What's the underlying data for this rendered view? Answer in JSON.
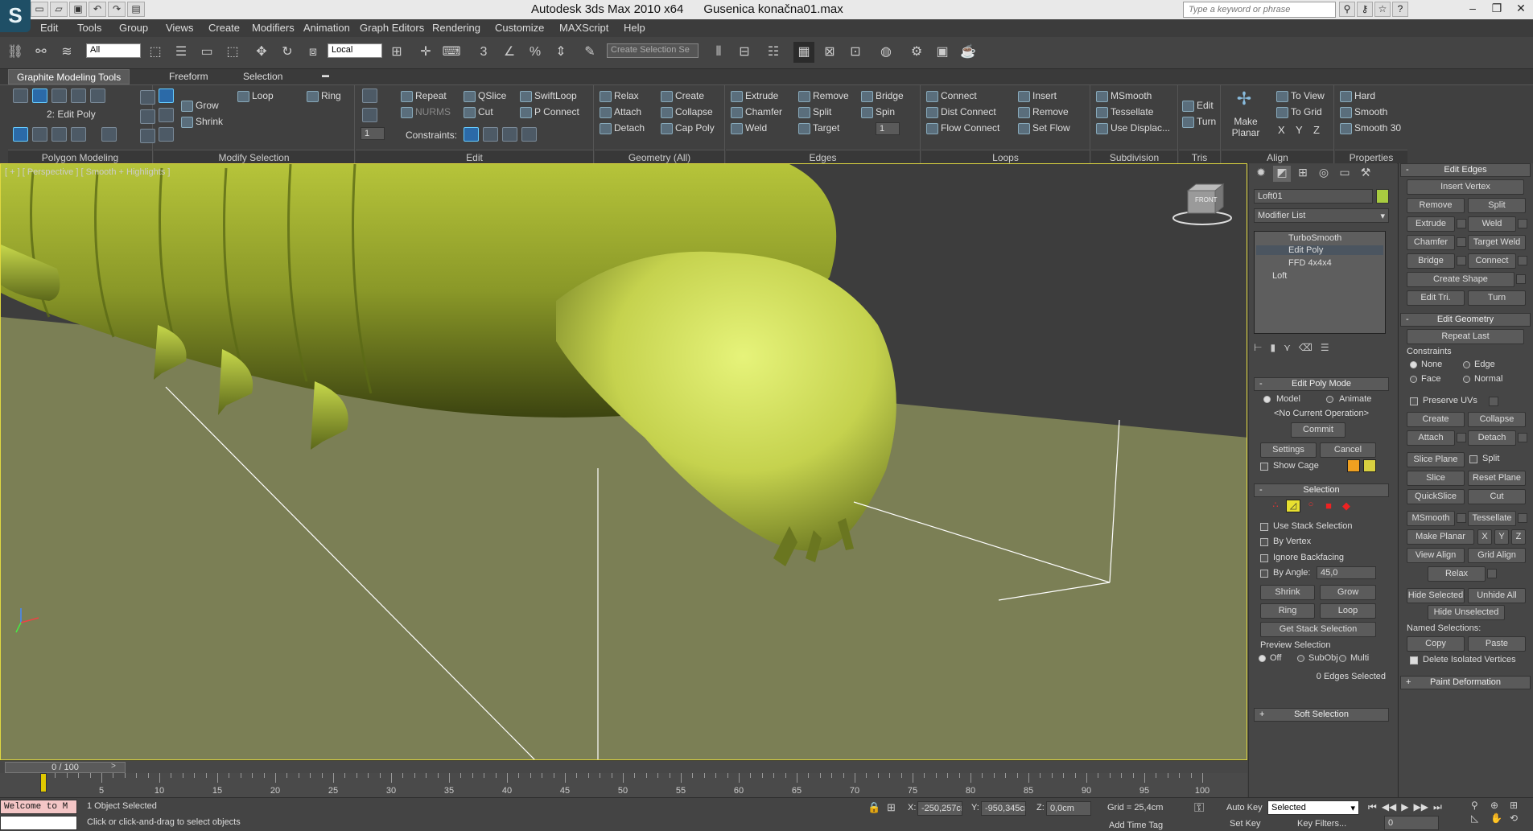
{
  "app": {
    "title": "Autodesk 3ds Max  2010 x64",
    "file": "Gusenica konačna01.max",
    "logo": "S"
  },
  "search": {
    "placeholder": "Type a keyword or phrase"
  },
  "menu": [
    "Edit",
    "Tools",
    "Group",
    "Views",
    "Create",
    "Modifiers",
    "Animation",
    "Graph Editors",
    "Rendering",
    "Customize",
    "MAXScript",
    "Help"
  ],
  "toolbar": {
    "filter": "All",
    "coord": "Local",
    "selection_set": "Create Selection Se"
  },
  "ribbon_tabs": [
    "Graphite Modeling Tools",
    "Freeform",
    "Selection"
  ],
  "ribbon": {
    "polygon_modeling": {
      "label": "Polygon Modeling",
      "mode": "2: Edit Poly"
    },
    "modify_selection": {
      "label": "Modify Selection",
      "grow": "Grow",
      "shrink": "Shrink",
      "loop": "Loop",
      "ring": "Ring"
    },
    "edit": {
      "label": "Edit",
      "repeat": "Repeat",
      "nurms": "NURMS",
      "qslice": "QSlice",
      "cut": "Cut",
      "swiftloop": "SwiftLoop",
      "pconnect": "P Connect",
      "constraints": "Constraints:",
      "spin_value": "1"
    },
    "geometry": {
      "label": "Geometry (All)",
      "relax": "Relax",
      "attach": "Attach",
      "detach": "Detach",
      "create": "Create",
      "collapse": "Collapse",
      "cap_poly": "Cap Poly"
    },
    "edges": {
      "label": "Edges",
      "extrude": "Extrude",
      "chamfer": "Chamfer",
      "weld": "Weld",
      "remove": "Remove",
      "split": "Split",
      "target": "Target",
      "bridge": "Bridge",
      "spin": "Spin",
      "spin_value": "1"
    },
    "loops": {
      "label": "Loops",
      "connect": "Connect",
      "dist_connect": "Dist Connect",
      "flow_connect": "Flow Connect",
      "insert": "Insert",
      "remove": "Remove",
      "set_flow": "Set Flow"
    },
    "subdivision": {
      "label": "Subdivision",
      "msmooth": "MSmooth",
      "tessellate": "Tessellate",
      "use_displac": "Use Displac..."
    },
    "tris": {
      "label": "Tris",
      "edit": "Edit",
      "turn": "Turn"
    },
    "align": {
      "label": "Align",
      "make_planar": "Make Planar",
      "to_view": "To View",
      "to_grid": "To Grid",
      "x": "X",
      "y": "Y",
      "z": "Z"
    },
    "properties": {
      "label": "Properties",
      "hard": "Hard",
      "smooth": "Smooth",
      "smooth30": "Smooth 30"
    }
  },
  "viewport": {
    "label": "[ + ] [ Perspective ] [ Smooth + Highlights ]",
    "viewcube": "FRONT"
  },
  "timeline": {
    "slider": "0 / 100",
    "ticks": [
      "5",
      "10",
      "15",
      "20",
      "25",
      "30",
      "35",
      "40",
      "45",
      "50",
      "55",
      "60",
      "65",
      "70",
      "75",
      "80",
      "85",
      "90",
      "95",
      "100"
    ]
  },
  "status": {
    "listener": "Welcome to M",
    "objects": "1 Object Selected",
    "prompt": "Click or click-and-drag to select objects",
    "x": "-250,257cr",
    "y": "-950,345cr",
    "z": "0,0cm",
    "x_label": "X:",
    "y_label": "Y:",
    "z_label": "Z:",
    "grid": "Grid = 25,4cm",
    "add_time_tag": "Add Time Tag",
    "auto_key": "Auto Key",
    "set_key": "Set Key",
    "key_mode": "Selected",
    "key_filters": "Key Filters...",
    "frame": "0"
  },
  "command_panel": {
    "object_name": "Loft01",
    "object_color": "#a8cc40",
    "modifier_list": "Modifier List",
    "stack": [
      "TurboSmooth",
      "Edit Poly",
      "FFD 4x4x4",
      "Loft"
    ],
    "edit_poly_mode": {
      "title": "Edit Poly Mode",
      "model": "Model",
      "animate": "Animate",
      "operation": "<No Current Operation>",
      "commit": "Commit",
      "settings": "Settings",
      "cancel": "Cancel",
      "show_cage": "Show Cage"
    },
    "selection": {
      "title": "Selection",
      "use_stack": "Use Stack Selection",
      "by_vertex": "By Vertex",
      "ignore_backfacing": "Ignore Backfacing",
      "by_angle": "By Angle:",
      "angle_value": "45,0",
      "shrink": "Shrink",
      "grow": "Grow",
      "ring": "Ring",
      "loop": "Loop",
      "get_stack": "Get Stack Selection",
      "preview": "Preview Selection",
      "off": "Off",
      "subobj": "SubObj",
      "multi": "Multi",
      "count": "0 Edges Selected"
    },
    "soft_selection": "Soft Selection"
  },
  "edit_edges": {
    "title": "Edit Edges",
    "insert_vertex": "Insert Vertex",
    "remove": "Remove",
    "split": "Split",
    "extrude": "Extrude",
    "weld": "Weld",
    "chamfer": "Chamfer",
    "target_weld": "Target Weld",
    "bridge": "Bridge",
    "connect": "Connect",
    "create_shape": "Create Shape",
    "edit_tri": "Edit Tri.",
    "turn": "Turn"
  },
  "edit_geometry": {
    "title": "Edit Geometry",
    "repeat_last": "Repeat Last",
    "constraints": "Constraints",
    "none": "None",
    "edge": "Edge",
    "face": "Face",
    "normal": "Normal",
    "preserve_uvs": "Preserve UVs",
    "create": "Create",
    "collapse": "Collapse",
    "attach": "Attach",
    "detach": "Detach",
    "slice_plane": "Slice Plane",
    "split": "Split",
    "slice": "Slice",
    "reset_plane": "Reset Plane",
    "quickslice": "QuickSlice",
    "cut": "Cut",
    "msmooth": "MSmooth",
    "tessellate": "Tessellate",
    "make_planar": "Make Planar",
    "x": "X",
    "y": "Y",
    "z": "Z",
    "view_align": "View Align",
    "grid_align": "Grid Align",
    "relax": "Relax",
    "hide_selected": "Hide Selected",
    "unhide_all": "Unhide All",
    "hide_unselected": "Hide Unselected",
    "named_selections": "Named Selections:",
    "copy": "Copy",
    "paste": "Paste",
    "delete_isolated": "Delete Isolated Vertices"
  },
  "paint_deformation": "Paint Deformation"
}
